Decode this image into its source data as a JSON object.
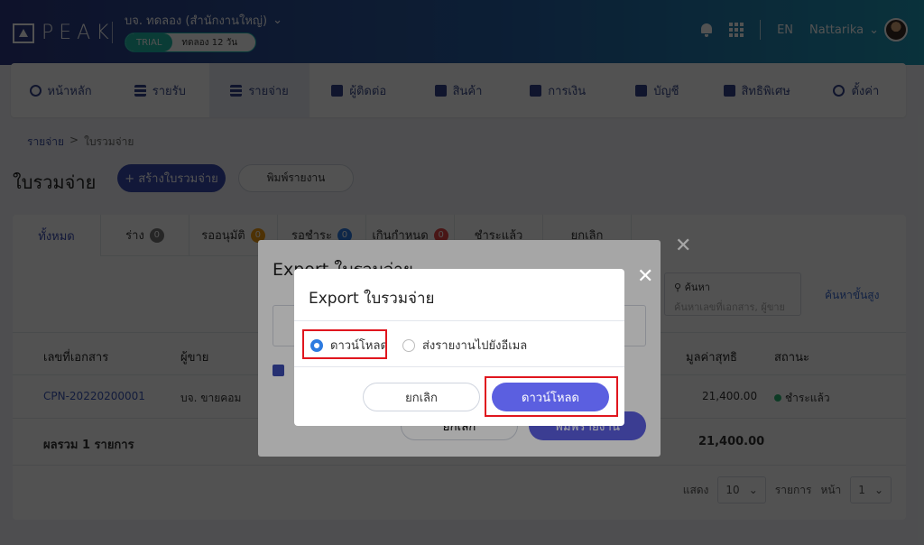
{
  "header": {
    "logo_text": "PEAK",
    "company": "บจ. ทดลอง (สำนักงานใหญ่)",
    "trial_label": "TRIAL",
    "trial_days": "ทดลอง 12 วัน",
    "lang": "EN",
    "user": "Nattarika"
  },
  "nav": [
    {
      "label": "หน้าหลัก",
      "icon": "home-icon"
    },
    {
      "label": "รายรับ",
      "icon": "list-icon"
    },
    {
      "label": "รายจ่าย",
      "icon": "list-icon"
    },
    {
      "label": "ผู้ติดต่อ",
      "icon": "contacts-icon"
    },
    {
      "label": "สินค้า",
      "icon": "box-icon"
    },
    {
      "label": "การเงิน",
      "icon": "money-icon"
    },
    {
      "label": "บัญชี",
      "icon": "book-icon"
    },
    {
      "label": "สิทธิพิเศษ",
      "icon": "megaphone-icon"
    },
    {
      "label": "ตั้งค่า",
      "icon": "gear-icon"
    }
  ],
  "breadcrumb": {
    "parent": "รายจ่าย",
    "sep": ">",
    "current": "ใบรวมจ่าย"
  },
  "page": {
    "title": "ใบรวมจ่าย",
    "create_label": "+ สร้างใบรวมจ่าย",
    "print_label": "พิมพ์รายงาน"
  },
  "tabs": [
    {
      "label": "ทั้งหมด",
      "count": ""
    },
    {
      "label": "ร่าง",
      "count": "0"
    },
    {
      "label": "รออนุมัติ",
      "count": "0"
    },
    {
      "label": "รอชำระ",
      "count": "0"
    },
    {
      "label": "เกินกำหนด",
      "count": "0"
    },
    {
      "label": "ชำระแล้ว",
      "count": ""
    },
    {
      "label": "ยกเลิก",
      "count": ""
    }
  ],
  "search": {
    "label": "ค้นหา",
    "placeholder": "ค้นหาเลขที่เอกสาร, ผู้ขาย",
    "advanced": "ค้นหาขั้นสูง"
  },
  "table": {
    "headers": {
      "doc": "เลขที่เอกสาร",
      "vendor": "ผู้ขาย",
      "net": "มูลค่าสุทธิ",
      "status": "สถานะ"
    },
    "rows": [
      {
        "doc": "CPN-20220200001",
        "vendor": "บจ. ขายคอม",
        "net": "21,400.00",
        "status": "ชำระแล้ว"
      }
    ],
    "total_label": "ผลรวม 1 รายการ",
    "total_value": "21,400.00"
  },
  "pager": {
    "show_label": "แสดง",
    "page_size": "10",
    "items_label": "รายการ",
    "page_label": "หน้า",
    "page": "1"
  },
  "back_modal": {
    "title": "Export ใบรวมจ่าย",
    "cancel": "ยกเลิก",
    "print": "พิมพ์รายงาน"
  },
  "modal": {
    "title": "Export ใบรวมจ่าย",
    "option_download": "ดาวน์โหลด",
    "option_email": "ส่งรายงานไปยังอีเมล",
    "selected": "download",
    "cancel": "ยกเลิก",
    "download": "ดาวน์โหลด"
  },
  "colors": {
    "primary": "#3b4bb0",
    "accent": "#5b5fe0",
    "highlight": "#e0161e",
    "paid": "#2bb673"
  }
}
